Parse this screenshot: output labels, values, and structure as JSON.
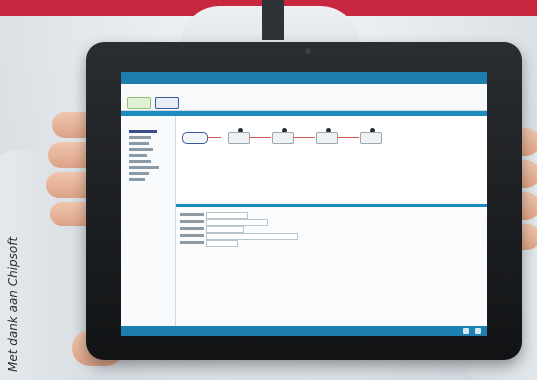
{
  "caption": "Met dank aan Chipsoft",
  "colors": {
    "accent_bar": "#c8283f",
    "app_blue": "#1c7fb0",
    "tablet_frame": "#1a1c1f"
  },
  "photo": {
    "subject": "person-holding-tablet",
    "screen": {
      "app": "hospital-information-system",
      "flow_node_count": 5,
      "flow_active_index": 0
    }
  }
}
